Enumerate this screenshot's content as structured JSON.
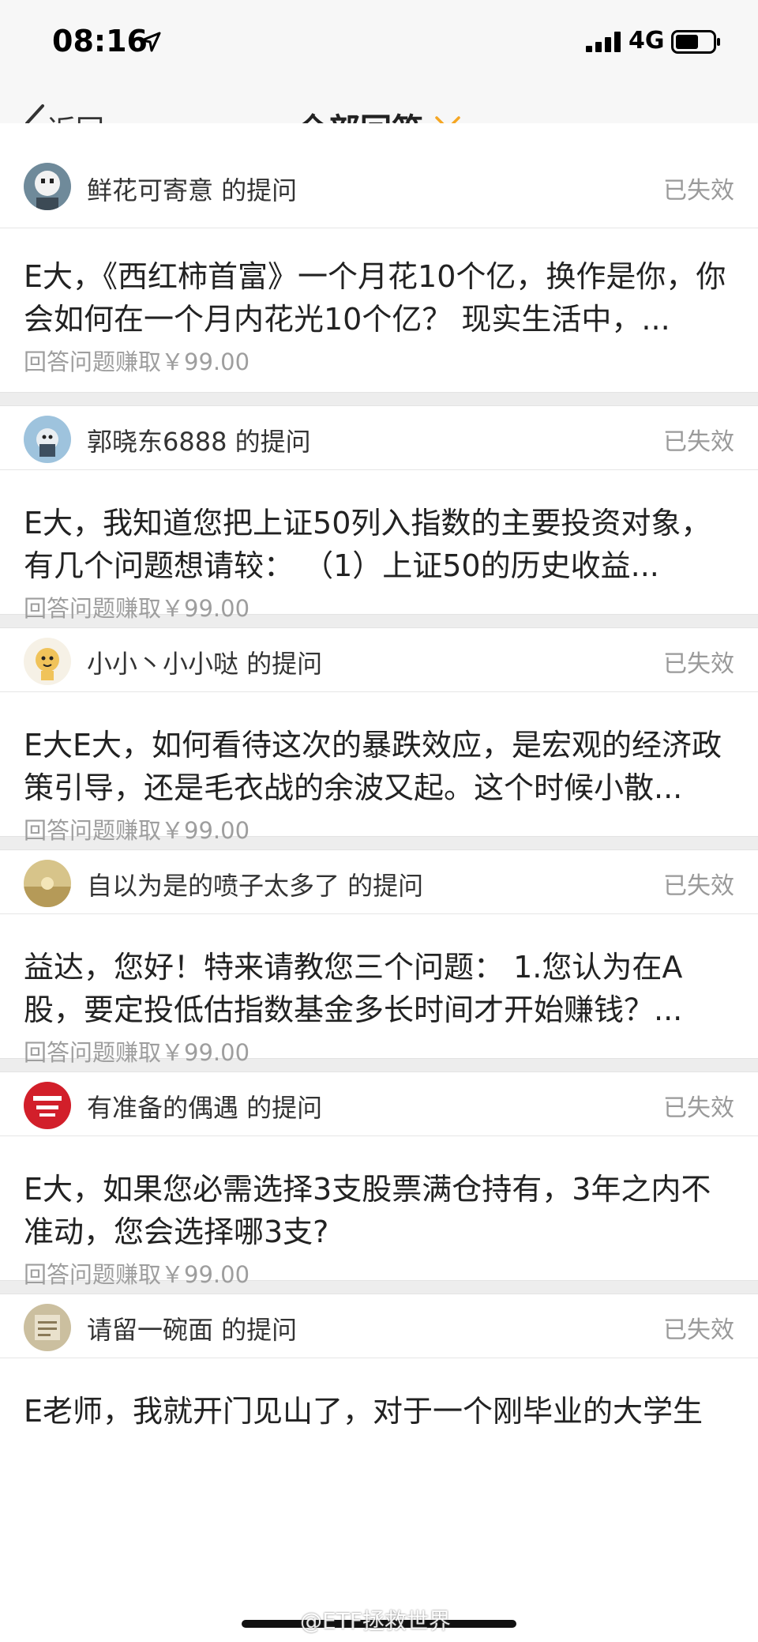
{
  "status_bar": {
    "time": "08:16",
    "network": "4G"
  },
  "nav": {
    "back_label": "返回",
    "title": "全部回答"
  },
  "cards": [
    {
      "asker": "鲜花可寄意 的提问",
      "status": "已失效",
      "question": "E大，《西红柿首富》一个月花10个亿，换作是你，你会如何在一个月内花光10个亿？ 现实生活中，...",
      "reward": "回答问题赚取￥99.00"
    },
    {
      "asker": "郭晓东6888 的提问",
      "status": "已失效",
      "question": "E大，我知道您把上证50列入指数的主要投资对象，有几个问题想请较：  （1）上证50的历史收益...",
      "reward": "回答问题赚取￥99.00"
    },
    {
      "asker": "小小丶小小哒 的提问",
      "status": "已失效",
      "question": "E大E大，如何看待这次的暴跌效应，是宏观的经济政策引导，还是毛衣战的余波又起。这个时候小散...",
      "reward": "回答问题赚取￥99.00"
    },
    {
      "asker": "自以为是的喷子太多了 的提问",
      "status": "已失效",
      "question": "益达，您好！特来请教您三个问题：  1.您认为在A股，要定投低估指数基金多长时间才开始赚钱？...",
      "reward": "回答问题赚取￥99.00"
    },
    {
      "asker": "有准备的偶遇 的提问",
      "status": "已失效",
      "question": "E大，如果您必需选择3支股票满仓持有，3年之内不准动，您会选择哪3支?",
      "reward": "回答问题赚取￥99.00"
    },
    {
      "asker": "请留一碗面 的提问",
      "status": "已失效",
      "question": "E老师，我就开门见山了，对于一个刚毕业的大学生",
      "reward": ""
    }
  ],
  "watermark": "@ETF拯救世界",
  "colors": {
    "accent": "#f5a623",
    "muted": "#9a9a9a",
    "separator": "#ededed"
  },
  "icons": [
    "location-arrow-icon",
    "signal-icon",
    "battery-icon",
    "back-chevron-icon",
    "dropdown-chevron-icon",
    "more-icon"
  ]
}
